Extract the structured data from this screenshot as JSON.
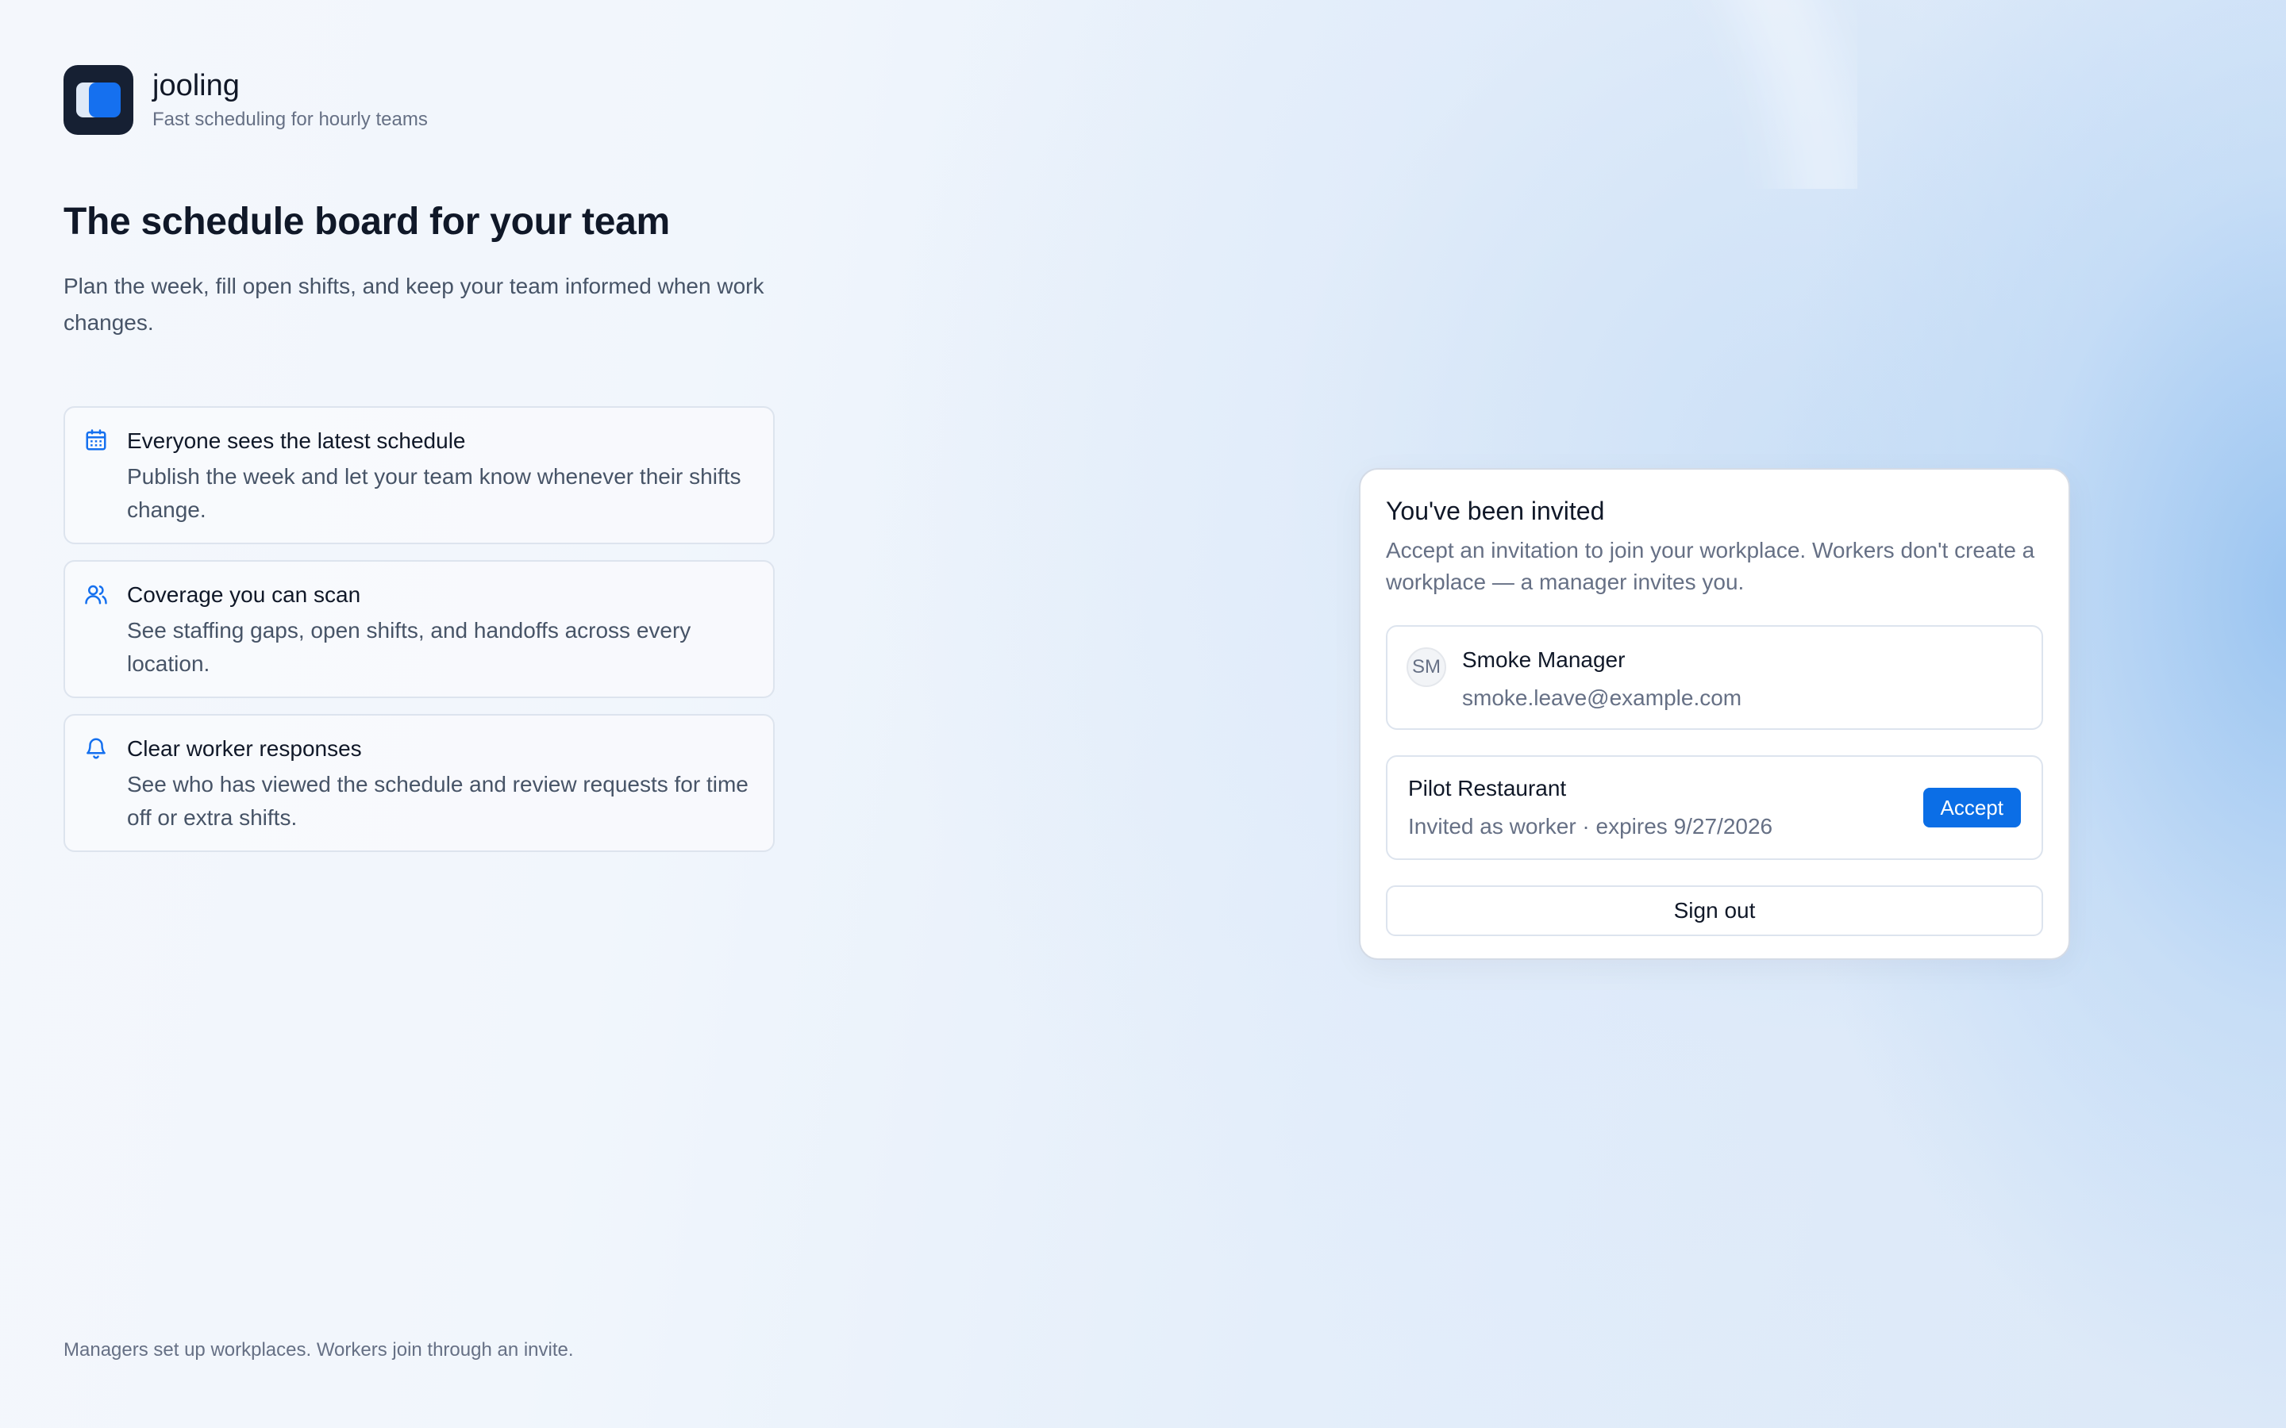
{
  "brand": {
    "name": "jooling",
    "tagline": "Fast scheduling for hourly teams"
  },
  "hero": {
    "title": "The schedule board for your team",
    "subtitle": "Plan the week, fill open shifts, and keep your team informed when work changes."
  },
  "features": [
    {
      "icon": "calendar-icon",
      "title": "Everyone sees the latest schedule",
      "description": "Publish the week and let your team know whenever their shifts change."
    },
    {
      "icon": "users-icon",
      "title": "Coverage you can scan",
      "description": "See staffing gaps, open shifts, and handoffs across every location."
    },
    {
      "icon": "bell-icon",
      "title": "Clear worker responses",
      "description": "See who has viewed the schedule and review requests for time off or extra shifts."
    }
  ],
  "footer": {
    "note": "Managers set up workplaces. Workers join through an invite."
  },
  "invite": {
    "title": "You've been invited",
    "description": "Accept an invitation to join your workplace. Workers don't create a workplace — a manager invites you.",
    "user": {
      "initials": "SM",
      "name": "Smoke Manager",
      "email": "smoke.leave@example.com"
    },
    "invitations": [
      {
        "workplace": "Pilot Restaurant",
        "meta": "Invited as worker · expires 9/27/2026",
        "accept_label": "Accept"
      }
    ],
    "sign_out_label": "Sign out"
  },
  "colors": {
    "accent": "#0b6ee6",
    "logo_bg": "#162033"
  }
}
